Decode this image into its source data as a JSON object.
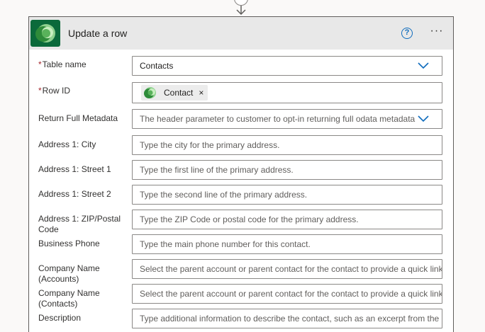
{
  "card": {
    "title": "Update a row",
    "help_icon": "question-circle-icon",
    "more_icon": "more-horizontal-icon",
    "help_glyph": "?",
    "more_glyph": "···"
  },
  "fields": {
    "table_name": {
      "label": "Table name",
      "required": "*",
      "value": "Contacts"
    },
    "row_id": {
      "label": "Row ID",
      "required": "*",
      "token": "Contact",
      "token_close": "×"
    },
    "return_metadata": {
      "label": "Return Full Metadata",
      "placeholder": "The header parameter to customer to opt-in returning full odata metadata"
    },
    "city": {
      "label": "Address 1: City",
      "placeholder": "Type the city for the primary address."
    },
    "street1": {
      "label": "Address 1: Street 1",
      "placeholder": "Type the first line of the primary address."
    },
    "street2": {
      "label": "Address 1: Street 2",
      "placeholder": "Type the second line of the primary address."
    },
    "zip": {
      "label": "Address 1: ZIP/Postal Code",
      "placeholder": "Type the ZIP Code or postal code for the primary address."
    },
    "phone": {
      "label": "Business Phone",
      "placeholder": "Type the main phone number for this contact."
    },
    "company_accounts": {
      "label": "Company Name (Accounts)",
      "placeholder": "Select the parent account or parent contact for the contact to provide a quick link"
    },
    "company_contacts": {
      "label": "Company Name (Contacts)",
      "placeholder": "Select the parent account or parent contact for the contact to provide a quick link"
    },
    "description": {
      "label": "Description",
      "placeholder": "Type additional information to describe the contact, such as an excerpt from the"
    }
  },
  "colors": {
    "accent": "#0f6cbd",
    "required": "#a4262c",
    "header_bg": "#e8e8e8",
    "logo_green": "#2e8b3a"
  }
}
